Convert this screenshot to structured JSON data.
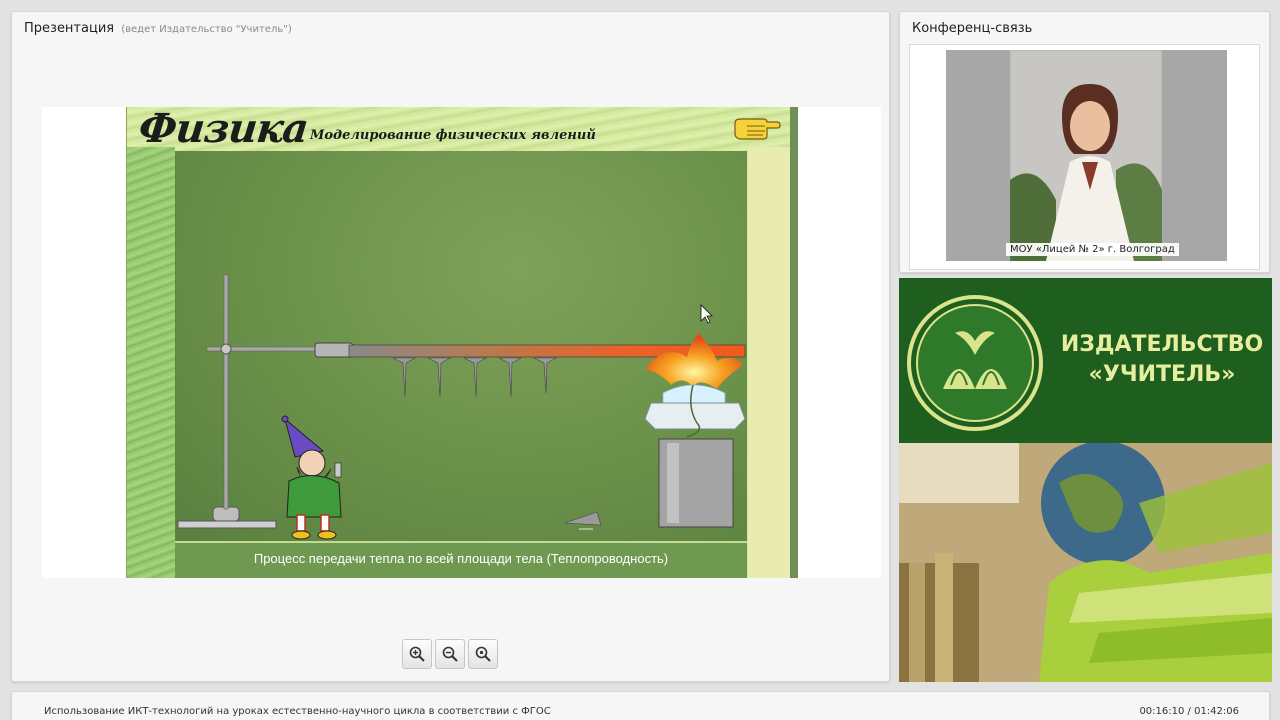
{
  "presentation": {
    "title": "Презентация",
    "presenter_note": "(ведет Издательство \"Учитель\")",
    "slide": {
      "title": "Физика",
      "subtitle": "Моделирование   физических   явлений",
      "caption": "Процесс передачи тепла по всей площади тела (Теплопроводность)"
    },
    "zoom_controls": [
      "zoom-in-icon",
      "zoom-out-icon",
      "zoom-reset-icon"
    ]
  },
  "conference": {
    "title": "Конференц-связь",
    "participant_caption": "МОУ «Лицей № 2» г. Волгоград"
  },
  "publisher": {
    "name_line1": "ИЗДАТЕЛЬСТВО",
    "name_line2": "«УЧИТЕЛЬ»"
  },
  "footer": {
    "course_title": "Использование ИКТ-технологий на уроках естественно-научного цикла в соответствии с ФГОС",
    "time": "00:16:10 / 01:42:06"
  },
  "colors": {
    "publisher_green": "#1e5e1e",
    "publisher_text": "#e8eda0",
    "slide_stage": "#6a9049"
  }
}
